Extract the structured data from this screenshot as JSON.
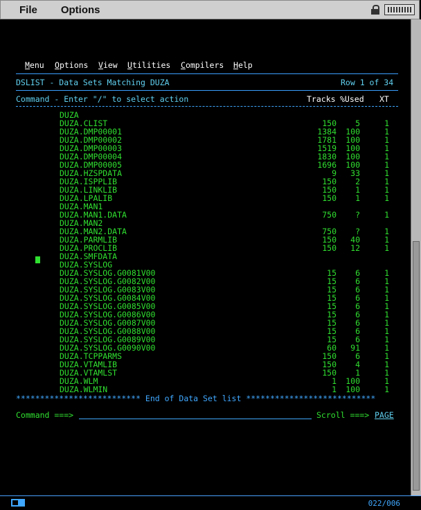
{
  "menubar": {
    "file": "File",
    "options": "Options"
  },
  "ispf_menu": [
    {
      "hot": "M",
      "rest": "enu",
      "name": "menu-menu"
    },
    {
      "hot": "O",
      "rest": "ptions",
      "name": "menu-options"
    },
    {
      "hot": "V",
      "rest": "iew",
      "name": "menu-view"
    },
    {
      "hot": "U",
      "rest": "tilities",
      "name": "menu-utilities"
    },
    {
      "hot": "C",
      "rest": "ompilers",
      "name": "menu-compilers"
    },
    {
      "hot": "H",
      "rest": "elp",
      "name": "menu-help"
    }
  ],
  "panel": {
    "title": "DSLIST - Data Sets Matching DUZA",
    "row_info": "Row 1 of 34",
    "instruction": "Command - Enter \"/\" to select action",
    "col_tracks": "Tracks",
    "col_used": "%Used",
    "col_xt": "XT"
  },
  "datasets": [
    {
      "name": "DUZA",
      "tracks": "",
      "used": "",
      "xt": ""
    },
    {
      "name": "DUZA.CLIST",
      "tracks": "150",
      "used": "5",
      "xt": "1"
    },
    {
      "name": "DUZA.DMP00001",
      "tracks": "1384",
      "used": "100",
      "xt": "1"
    },
    {
      "name": "DUZA.DMP00002",
      "tracks": "1781",
      "used": "100",
      "xt": "1"
    },
    {
      "name": "DUZA.DMP00003",
      "tracks": "1519",
      "used": "100",
      "xt": "1"
    },
    {
      "name": "DUZA.DMP00004",
      "tracks": "1830",
      "used": "100",
      "xt": "1"
    },
    {
      "name": "DUZA.DMP00005",
      "tracks": "1696",
      "used": "100",
      "xt": "1"
    },
    {
      "name": "DUZA.HZSPDATA",
      "tracks": "9",
      "used": "33",
      "xt": "1"
    },
    {
      "name": "DUZA.ISPPLIB",
      "tracks": "150",
      "used": "2",
      "xt": "1"
    },
    {
      "name": "DUZA.LINKLIB",
      "tracks": "150",
      "used": "1",
      "xt": "1"
    },
    {
      "name": "DUZA.LPALIB",
      "tracks": "150",
      "used": "1",
      "xt": "1"
    },
    {
      "name": "DUZA.MAN1",
      "tracks": "",
      "used": "",
      "xt": ""
    },
    {
      "name": "DUZA.MAN1.DATA",
      "tracks": "750",
      "used": "?",
      "xt": "1"
    },
    {
      "name": "DUZA.MAN2",
      "tracks": "",
      "used": "",
      "xt": ""
    },
    {
      "name": "DUZA.MAN2.DATA",
      "tracks": "750",
      "used": "?",
      "xt": "1"
    },
    {
      "name": "DUZA.PARMLIB",
      "tracks": "150",
      "used": "40",
      "xt": "1"
    },
    {
      "name": "DUZA.PROCLIB",
      "tracks": "150",
      "used": "12",
      "xt": "1"
    },
    {
      "name": "DUZA.SMFDATA",
      "tracks": "",
      "used": "",
      "xt": ""
    },
    {
      "name": "DUZA.SYSLOG",
      "tracks": "",
      "used": "",
      "xt": ""
    },
    {
      "name": "DUZA.SYSLOG.G0081V00",
      "tracks": "15",
      "used": "6",
      "xt": "1"
    },
    {
      "name": "DUZA.SYSLOG.G0082V00",
      "tracks": "15",
      "used": "6",
      "xt": "1"
    },
    {
      "name": "DUZA.SYSLOG.G0083V00",
      "tracks": "15",
      "used": "6",
      "xt": "1"
    },
    {
      "name": "DUZA.SYSLOG.G0084V00",
      "tracks": "15",
      "used": "6",
      "xt": "1"
    },
    {
      "name": "DUZA.SYSLOG.G0085V00",
      "tracks": "15",
      "used": "6",
      "xt": "1"
    },
    {
      "name": "DUZA.SYSLOG.G0086V00",
      "tracks": "15",
      "used": "6",
      "xt": "1"
    },
    {
      "name": "DUZA.SYSLOG.G0087V00",
      "tracks": "15",
      "used": "6",
      "xt": "1"
    },
    {
      "name": "DUZA.SYSLOG.G0088V00",
      "tracks": "15",
      "used": "6",
      "xt": "1"
    },
    {
      "name": "DUZA.SYSLOG.G0089V00",
      "tracks": "15",
      "used": "6",
      "xt": "1"
    },
    {
      "name": "DUZA.SYSLOG.G0090V00",
      "tracks": "60",
      "used": "91",
      "xt": "1"
    },
    {
      "name": "DUZA.TCPPARMS",
      "tracks": "150",
      "used": "6",
      "xt": "1"
    },
    {
      "name": "DUZA.VTAMLIB",
      "tracks": "150",
      "used": "4",
      "xt": "1"
    },
    {
      "name": "DUZA.VTAMLST",
      "tracks": "150",
      "used": "1",
      "xt": "1"
    },
    {
      "name": "DUZA.WLM",
      "tracks": "1",
      "used": "100",
      "xt": "1"
    },
    {
      "name": "DUZA.WLMIN",
      "tracks": "1",
      "used": "100",
      "xt": "1"
    }
  ],
  "end_line": "************************** End of Data Set list ***************************",
  "command": {
    "label": "Command ===>",
    "scroll_label": "Scroll ===>",
    "scroll_value": "PAGE"
  },
  "status": {
    "cursor_pos": "022/006"
  }
}
